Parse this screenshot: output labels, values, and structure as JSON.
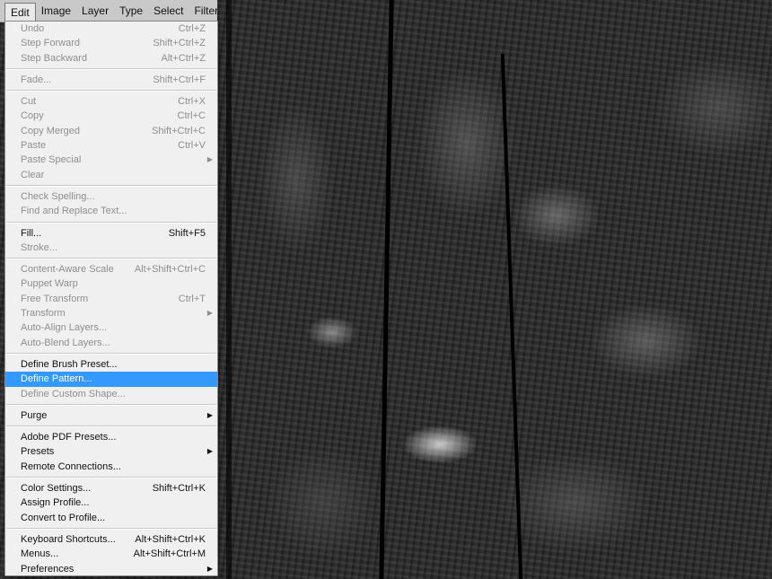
{
  "menubar": {
    "items": [
      "Edit",
      "Image",
      "Layer",
      "Type",
      "Select",
      "Filter"
    ]
  },
  "menu": {
    "groups": [
      [
        {
          "label": "Undo",
          "shortcut": "Ctrl+Z",
          "disabled": true
        },
        {
          "label": "Step Forward",
          "shortcut": "Shift+Ctrl+Z",
          "disabled": true
        },
        {
          "label": "Step Backward",
          "shortcut": "Alt+Ctrl+Z",
          "disabled": true
        }
      ],
      [
        {
          "label": "Fade...",
          "shortcut": "Shift+Ctrl+F",
          "disabled": true
        }
      ],
      [
        {
          "label": "Cut",
          "shortcut": "Ctrl+X",
          "disabled": true
        },
        {
          "label": "Copy",
          "shortcut": "Ctrl+C",
          "disabled": true
        },
        {
          "label": "Copy Merged",
          "shortcut": "Shift+Ctrl+C",
          "disabled": true
        },
        {
          "label": "Paste",
          "shortcut": "Ctrl+V",
          "disabled": true
        },
        {
          "label": "Paste Special",
          "shortcut": "",
          "submenu": true,
          "disabled": true
        },
        {
          "label": "Clear",
          "shortcut": "",
          "disabled": true
        }
      ],
      [
        {
          "label": "Check Spelling...",
          "shortcut": "",
          "disabled": true
        },
        {
          "label": "Find and Replace Text...",
          "shortcut": "",
          "disabled": true
        }
      ],
      [
        {
          "label": "Fill...",
          "shortcut": "Shift+F5",
          "disabled": false
        },
        {
          "label": "Stroke...",
          "shortcut": "",
          "disabled": true
        }
      ],
      [
        {
          "label": "Content-Aware Scale",
          "shortcut": "Alt+Shift+Ctrl+C",
          "disabled": true
        },
        {
          "label": "Puppet Warp",
          "shortcut": "",
          "disabled": true
        },
        {
          "label": "Free Transform",
          "shortcut": "Ctrl+T",
          "disabled": true
        },
        {
          "label": "Transform",
          "shortcut": "",
          "submenu": true,
          "disabled": true
        },
        {
          "label": "Auto-Align Layers...",
          "shortcut": "",
          "disabled": true
        },
        {
          "label": "Auto-Blend Layers...",
          "shortcut": "",
          "disabled": true
        }
      ],
      [
        {
          "label": "Define Brush Preset...",
          "shortcut": "",
          "disabled": false
        },
        {
          "label": "Define Pattern...",
          "shortcut": "",
          "disabled": false,
          "highlight": true
        },
        {
          "label": "Define Custom Shape...",
          "shortcut": "",
          "disabled": true
        }
      ],
      [
        {
          "label": "Purge",
          "shortcut": "",
          "submenu": true,
          "disabled": false
        }
      ],
      [
        {
          "label": "Adobe PDF Presets...",
          "shortcut": "",
          "disabled": false
        },
        {
          "label": "Presets",
          "shortcut": "",
          "submenu": true,
          "disabled": false
        },
        {
          "label": "Remote Connections...",
          "shortcut": "",
          "disabled": false
        }
      ],
      [
        {
          "label": "Color Settings...",
          "shortcut": "Shift+Ctrl+K",
          "disabled": false
        },
        {
          "label": "Assign Profile...",
          "shortcut": "",
          "disabled": false
        },
        {
          "label": "Convert to Profile...",
          "shortcut": "",
          "disabled": false
        }
      ],
      [
        {
          "label": "Keyboard Shortcuts...",
          "shortcut": "Alt+Shift+Ctrl+K",
          "disabled": false
        },
        {
          "label": "Menus...",
          "shortcut": "Alt+Shift+Ctrl+M",
          "disabled": false
        },
        {
          "label": "Preferences",
          "shortcut": "",
          "submenu": true,
          "disabled": false
        }
      ]
    ]
  },
  "colors": {
    "highlight": "#3399ff",
    "menu_bg": "#f0f0f0",
    "disabled_text": "#8e8e8e"
  },
  "icons": {
    "submenu": "submenu-arrow-icon"
  }
}
